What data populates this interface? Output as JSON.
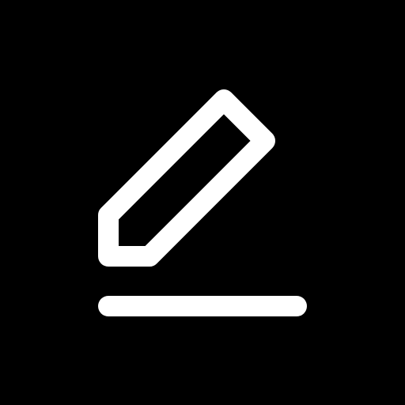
{
  "icon": {
    "name": "edit-icon",
    "background": "#000000",
    "stroke": "#ffffff"
  }
}
